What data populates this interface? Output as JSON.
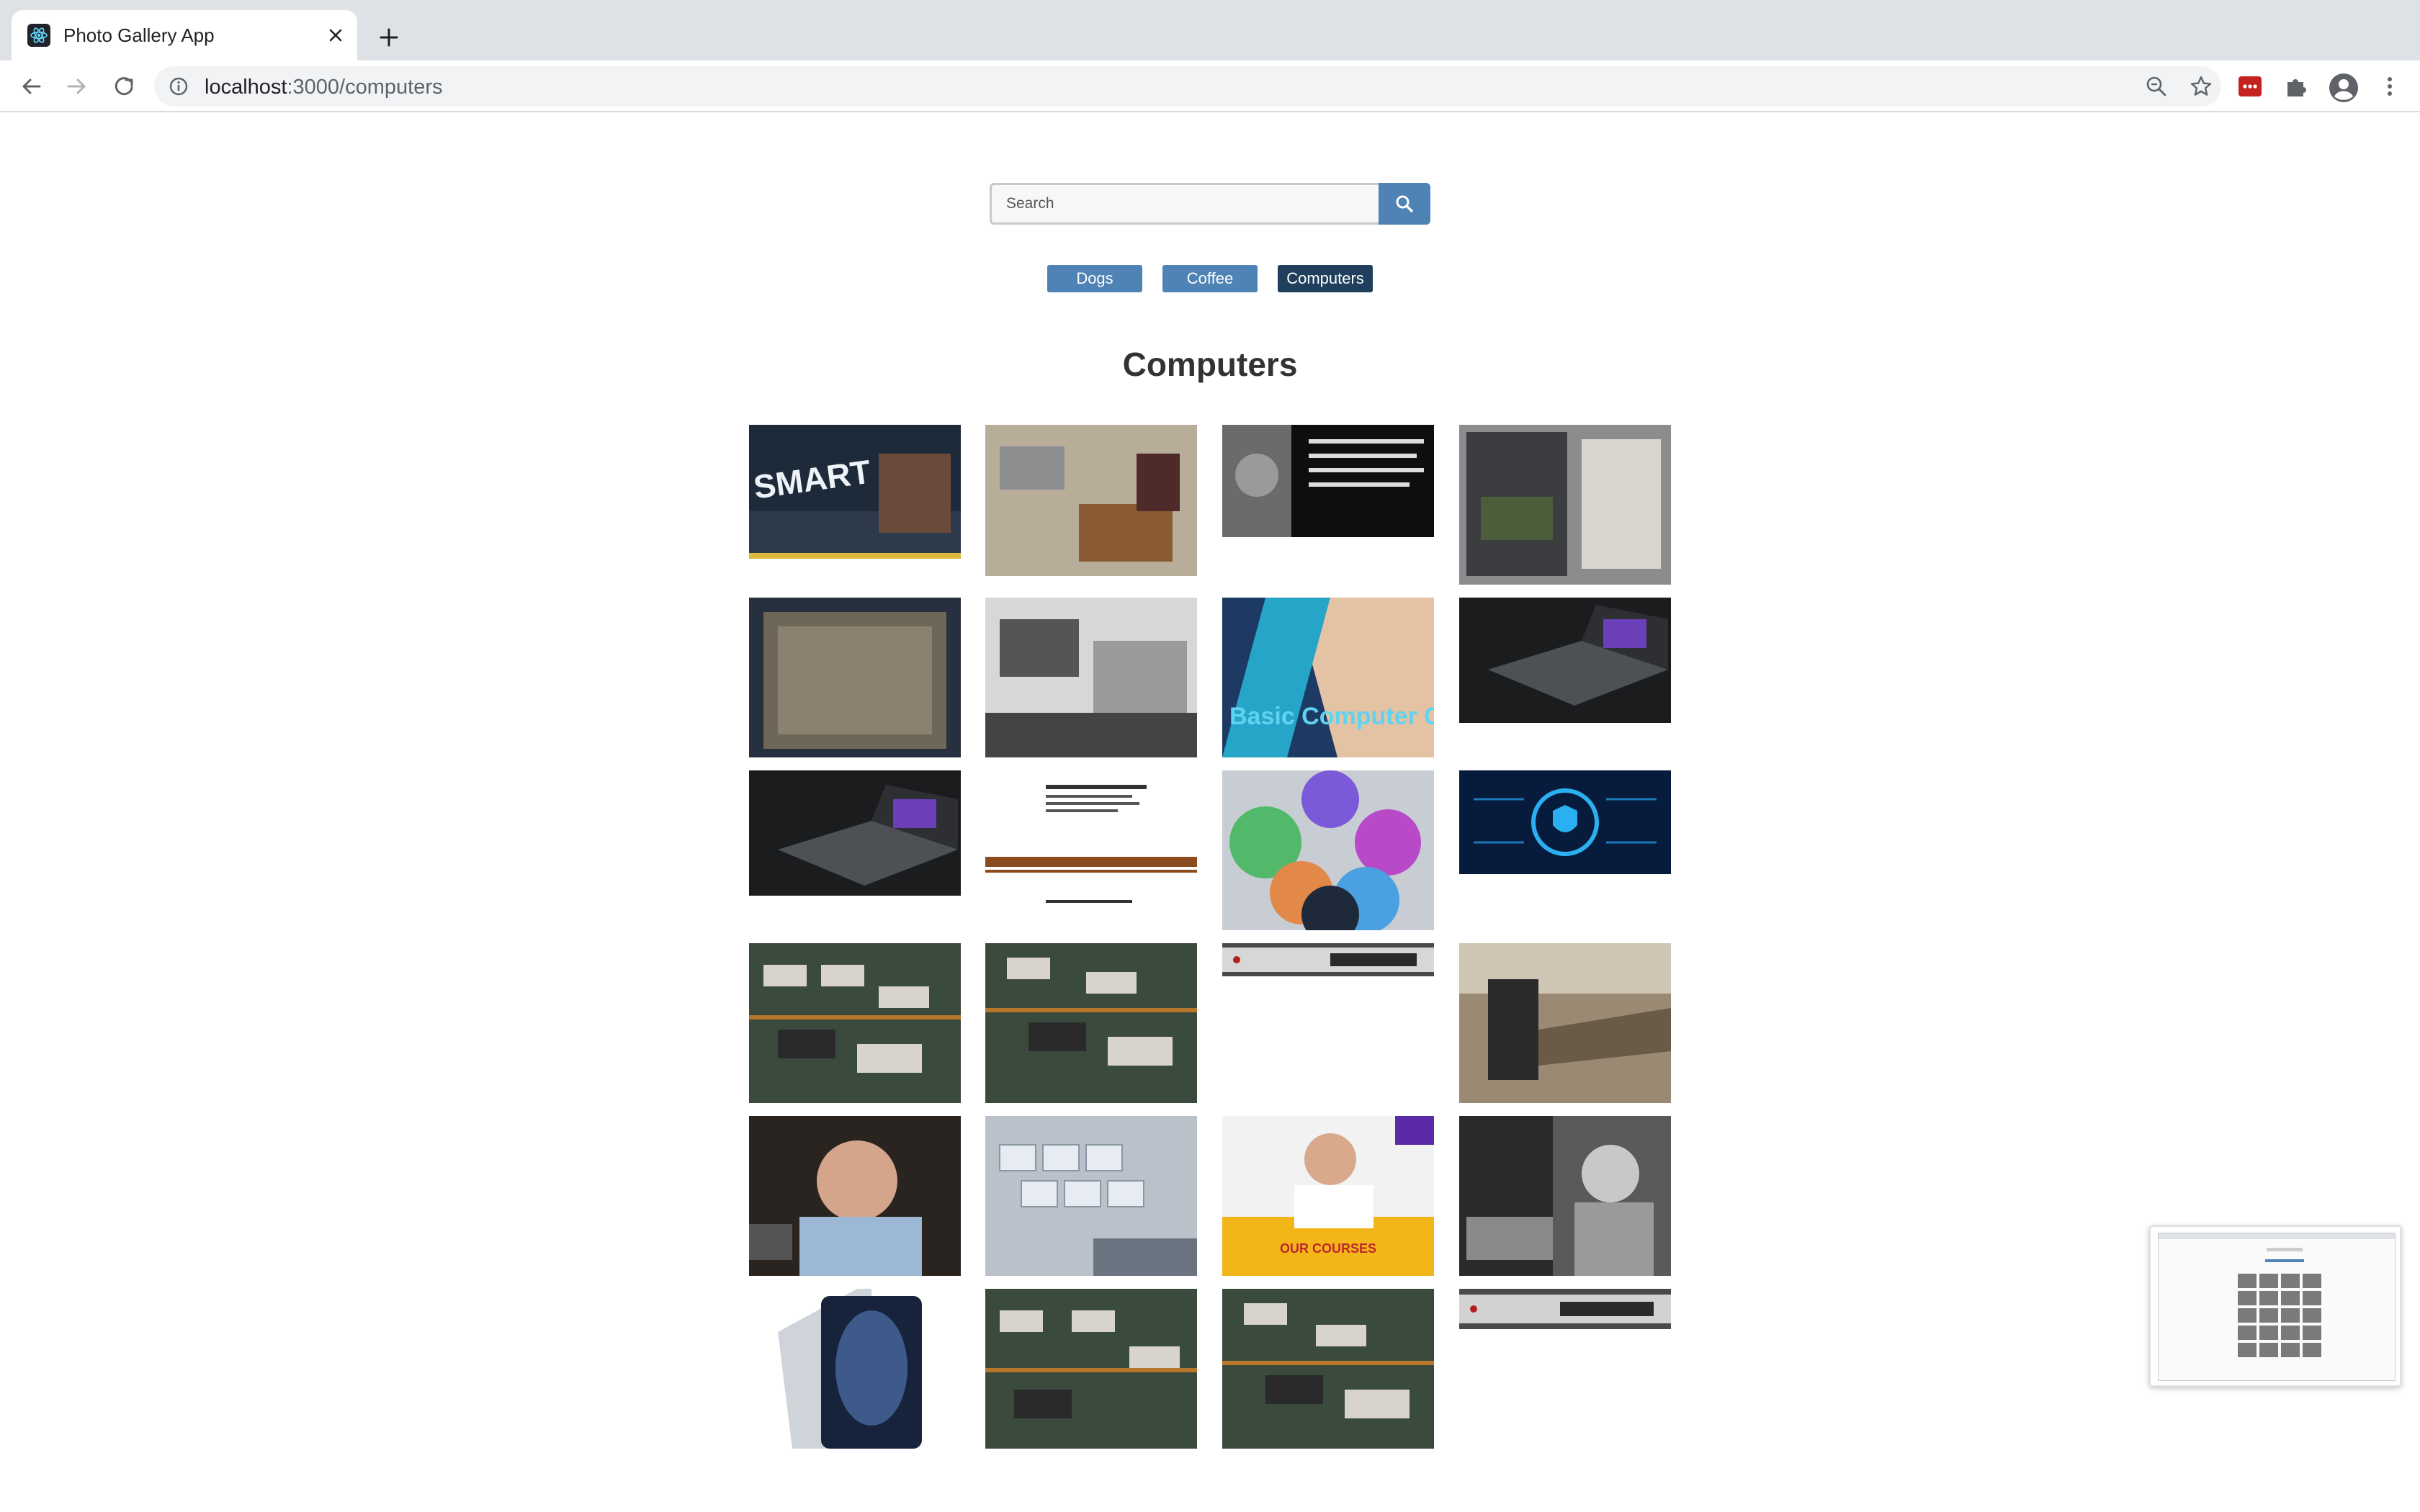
{
  "browser": {
    "tab_title": "Photo Gallery App",
    "url_host": "localhost",
    "url_path": ":3000/computers"
  },
  "search": {
    "placeholder": "Search",
    "value": ""
  },
  "categories": [
    {
      "label": "Dogs",
      "active": false
    },
    {
      "label": "Coffee",
      "active": false
    },
    {
      "label": "Computers",
      "active": true
    }
  ],
  "heading": "Computers",
  "photos": [
    {
      "subject": "smart-technologies",
      "caption": ""
    },
    {
      "subject": "computer-lab-office",
      "caption": ""
    },
    {
      "subject": "information-quote",
      "caption": ""
    },
    {
      "subject": "open-pc-case",
      "caption": ""
    },
    {
      "subject": "cooler-master-case",
      "caption": ""
    },
    {
      "subject": "woman-at-computer-bw",
      "caption": ""
    },
    {
      "subject": "basic-computer-course",
      "caption": "Basic Computer Course"
    },
    {
      "subject": "laptop-dark",
      "caption": ""
    },
    {
      "subject": "laptop-dark-2",
      "caption": ""
    },
    {
      "subject": "mai-business-card",
      "caption": ""
    },
    {
      "subject": "programming-languages",
      "caption": ""
    },
    {
      "subject": "cyber-security-shield",
      "caption": ""
    },
    {
      "subject": "circuit-board",
      "caption": ""
    },
    {
      "subject": "circuit-board-2",
      "caption": ""
    },
    {
      "subject": "rack-unit",
      "caption": ""
    },
    {
      "subject": "woman-laptop-library",
      "caption": ""
    },
    {
      "subject": "man-portrait",
      "caption": ""
    },
    {
      "subject": "keyboard-closeup",
      "caption": ""
    },
    {
      "subject": "computer-courses-ad",
      "caption": "OUR COURSES"
    },
    {
      "subject": "vintage-computing-bw",
      "caption": ""
    },
    {
      "subject": "tablet-device",
      "caption": ""
    },
    {
      "subject": "circuit-board-3",
      "caption": ""
    },
    {
      "subject": "circuit-board-4",
      "caption": ""
    },
    {
      "subject": "rack-unit-2",
      "caption": ""
    }
  ],
  "colors": {
    "button": "#4f82b5",
    "button_active": "#1f3f5c",
    "heading": "#333333"
  },
  "icons": [
    "back-icon",
    "forward-icon",
    "reload-icon",
    "info-icon",
    "zoom-icon",
    "star-icon",
    "extension-icon",
    "puzzle-icon",
    "profile-icon",
    "menu-icon",
    "search-icon"
  ]
}
